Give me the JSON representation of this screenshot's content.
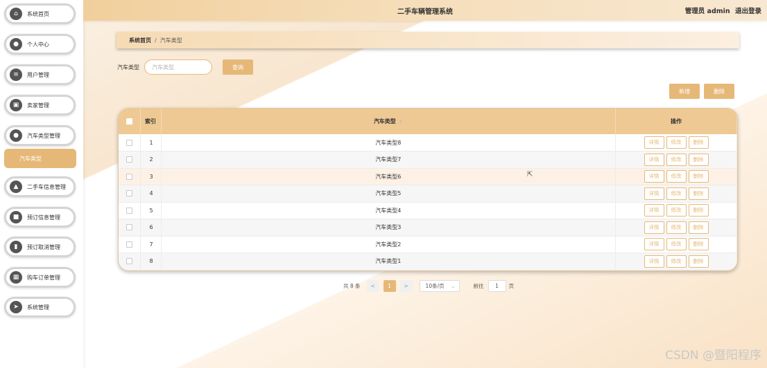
{
  "sidebar": {
    "items": [
      {
        "label": "系统首页",
        "icon": "home-icon",
        "glyph": "⌂"
      },
      {
        "label": "个人中心",
        "icon": "user-icon",
        "glyph": "●"
      },
      {
        "label": "用户管理",
        "icon": "list-icon",
        "glyph": "≡"
      },
      {
        "label": "卖家管理",
        "icon": "briefcase-icon",
        "glyph": "▣"
      },
      {
        "label": "汽车类型管理",
        "icon": "user-icon",
        "glyph": "●"
      },
      {
        "label": "二手车信息管理",
        "icon": "thumb-icon",
        "glyph": "▲"
      },
      {
        "label": "预订信息管理",
        "icon": "chat-icon",
        "glyph": "■"
      },
      {
        "label": "预订取消管理",
        "icon": "bar-chart-icon",
        "glyph": "▮"
      },
      {
        "label": "购车订单管理",
        "icon": "grid-icon",
        "glyph": "▦"
      },
      {
        "label": "系统管理",
        "icon": "send-icon",
        "glyph": "➤"
      }
    ],
    "active_sub": "汽车类型"
  },
  "header": {
    "title": "二手车辆管理系统",
    "user": "管理员 admin",
    "logout": "退出登录"
  },
  "breadcrumb": {
    "home": "系统首页",
    "separator": "/",
    "current": "汽车类型"
  },
  "search": {
    "label": "汽车类型",
    "placeholder": "汽车类型",
    "button": "查询"
  },
  "actions": {
    "add": "新增",
    "delete": "删除"
  },
  "table": {
    "headers": {
      "index": "索引",
      "type": "汽车类型",
      "ops": "操作"
    },
    "op_labels": {
      "detail": "详情",
      "edit": "修改",
      "delete": "删除"
    },
    "rows": [
      {
        "index": "1",
        "type": "汽车类型8"
      },
      {
        "index": "2",
        "type": "汽车类型7"
      },
      {
        "index": "3",
        "type": "汽车类型6"
      },
      {
        "index": "4",
        "type": "汽车类型5"
      },
      {
        "index": "5",
        "type": "汽车类型4"
      },
      {
        "index": "6",
        "type": "汽车类型3"
      },
      {
        "index": "7",
        "type": "汽车类型2"
      },
      {
        "index": "8",
        "type": "汽车类型1"
      }
    ]
  },
  "pagination": {
    "total": "共 8 条",
    "prev": "<",
    "current": "1",
    "next": ">",
    "page_size": "10条/页",
    "goto": "前往",
    "page_value": "1",
    "page_suffix": "页"
  },
  "watermark": "CSDN @暨阳程序",
  "colors": {
    "accent": "#e6b877",
    "header": "#f1cf9c"
  }
}
